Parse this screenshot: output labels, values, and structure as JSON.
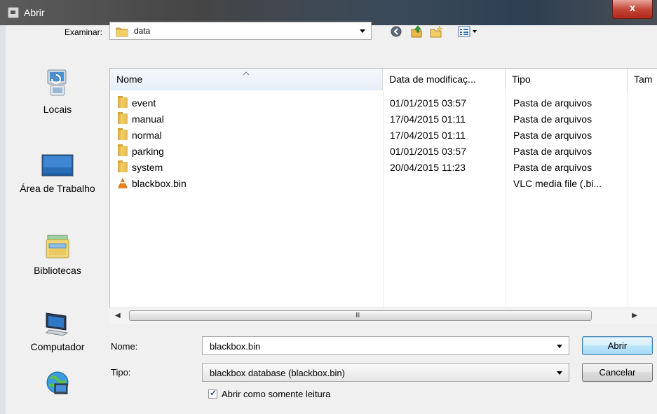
{
  "window": {
    "title": "Abrir",
    "close_label": "x"
  },
  "toolbar": {
    "lookin_label": "Examinar:",
    "lookin_value": "data"
  },
  "places": [
    {
      "label": "Locais",
      "icon": "recent-places-icon"
    },
    {
      "label": "Área de Trabalho",
      "icon": "desktop-icon"
    },
    {
      "label": "Bibliotecas",
      "icon": "libraries-icon"
    },
    {
      "label": "Computador",
      "icon": "computer-icon"
    },
    {
      "label": "",
      "icon": "network-icon"
    }
  ],
  "columns": {
    "name": "Nome",
    "date": "Data de modificaç...",
    "type": "Tipo",
    "size": "Tam"
  },
  "files": [
    {
      "name": "event",
      "date": "01/01/2015 03:57",
      "type": "Pasta de arquivos",
      "icon": "folder-icon"
    },
    {
      "name": "manual",
      "date": "17/04/2015 01:11",
      "type": "Pasta de arquivos",
      "icon": "folder-icon"
    },
    {
      "name": "normal",
      "date": "17/04/2015 01:11",
      "type": "Pasta de arquivos",
      "icon": "folder-icon"
    },
    {
      "name": "parking",
      "date": "01/01/2015 03:57",
      "type": "Pasta de arquivos",
      "icon": "folder-icon"
    },
    {
      "name": "system",
      "date": "20/04/2015 11:23",
      "type": "Pasta de arquivos",
      "icon": "folder-icon"
    },
    {
      "name": "blackbox.bin",
      "date": "",
      "type": "VLC media file (.bi...",
      "icon": "vlc-icon"
    }
  ],
  "scrollbar": {
    "grip": "III"
  },
  "form": {
    "name_label": "Nome:",
    "name_value": "blackbox.bin",
    "type_label": "Tipo:",
    "type_value": "blackbox database (blackbox.bin)",
    "open_button": "Abrir",
    "cancel_button": "Cancelar",
    "readonly_label": "Abrir como somente leitura",
    "readonly_checked": true
  },
  "colors": {
    "accent": "#3c7fb1",
    "folder": "#e6b84a",
    "close": "#c5473a"
  }
}
